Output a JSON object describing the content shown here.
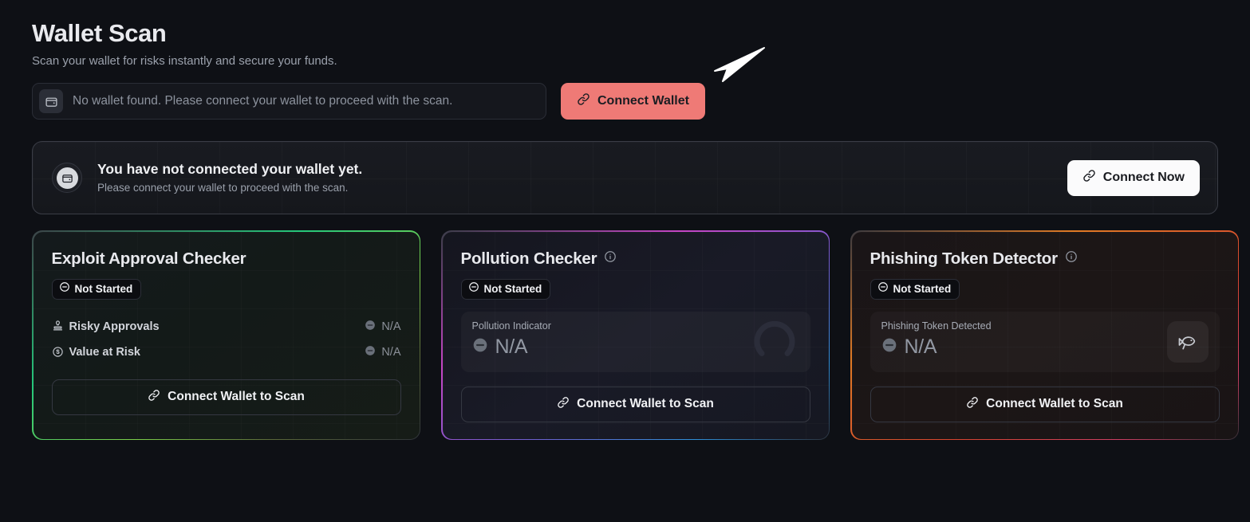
{
  "header": {
    "title": "Wallet Scan",
    "subtitle": "Scan your wallet for risks instantly and secure your funds."
  },
  "wallet_row": {
    "field_text": "No wallet found. Please connect your wallet to proceed with the scan.",
    "field_icon": "wallet-icon",
    "connect_button": {
      "label": "Connect Wallet",
      "icon": "link-icon",
      "background_color": "#ef7a76",
      "text_color": "#1b1d22"
    }
  },
  "banner": {
    "icon": "wallet-icon",
    "title": "You have not connected your wallet yet.",
    "subtitle": "Please connect your wallet to proceed with the scan.",
    "action": {
      "label": "Connect Now",
      "icon": "link-icon",
      "background_color": "#fbfbfc",
      "text_color": "#191b20"
    }
  },
  "cards": [
    {
      "id": "exploit-approval-checker",
      "title": "Exploit Approval Checker",
      "has_info_icon": false,
      "status": {
        "label": "Not Started",
        "icon": "circle-minus-icon"
      },
      "layout": "metrics",
      "metrics": [
        {
          "icon": "stamp-icon",
          "label": "Risky Approvals",
          "value": "N/A",
          "value_icon": "circle-dash-icon"
        },
        {
          "icon": "dollar-circle-icon",
          "label": "Value at Risk",
          "value": "N/A",
          "value_icon": "circle-dash-icon"
        }
      ],
      "action": {
        "label": "Connect Wallet to Scan",
        "icon": "link-icon"
      },
      "accent_colors": [
        "#25c77a",
        "#7dd04a"
      ]
    },
    {
      "id": "pollution-checker",
      "title": "Pollution Checker",
      "has_info_icon": true,
      "info_icon": "info-icon",
      "status": {
        "label": "Not Started",
        "icon": "circle-minus-icon"
      },
      "layout": "panel",
      "panel": {
        "label": "Pollution Indicator",
        "value": "N/A",
        "value_icon": "circle-dash-icon",
        "art": "gauge-arc"
      },
      "action": {
        "label": "Connect Wallet to Scan",
        "icon": "link-icon"
      },
      "accent_colors": [
        "#c545c5",
        "#2c8fd8"
      ]
    },
    {
      "id": "phishing-token-detector",
      "title": "Phishing Token Detector",
      "has_info_icon": true,
      "info_icon": "info-icon",
      "status": {
        "label": "Not Started",
        "icon": "circle-minus-icon"
      },
      "layout": "panel",
      "panel": {
        "label": "Phishing Token Detected",
        "value": "N/A",
        "value_icon": "circle-dash-icon",
        "art": "fish-icon"
      },
      "action": {
        "label": "Connect Wallet to Scan",
        "icon": "link-icon"
      },
      "accent_colors": [
        "#e07a24",
        "#cf3f63"
      ]
    }
  ],
  "cursor": {
    "type": "arrow-pointer"
  }
}
